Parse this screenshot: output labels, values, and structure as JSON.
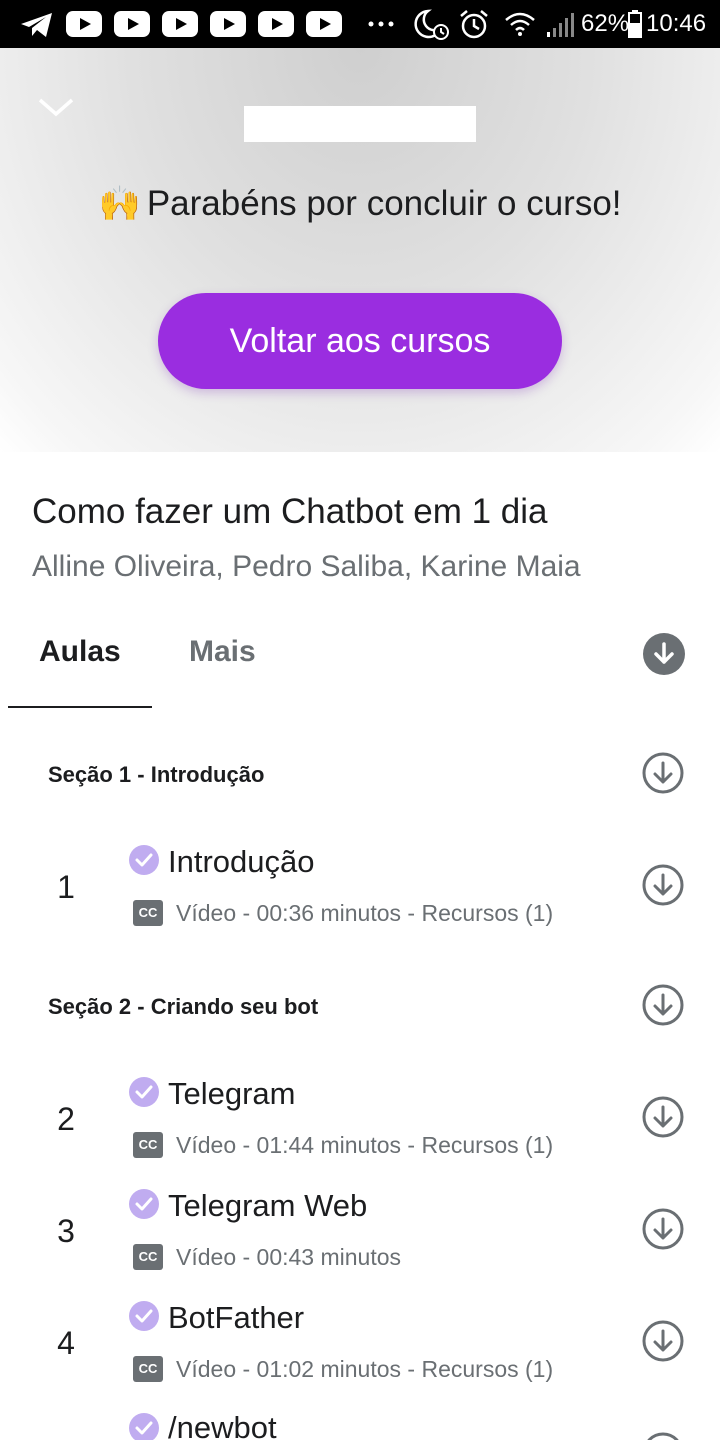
{
  "status_bar": {
    "battery": "62%",
    "time": "10:46",
    "icons": [
      "telegram-icon",
      "youtube-icon",
      "youtube-icon",
      "youtube-icon",
      "youtube-icon",
      "youtube-icon",
      "more-dots-icon",
      "moon-clock-icon",
      "alarm-icon",
      "wifi-icon",
      "signal-icon",
      "battery-icon"
    ]
  },
  "hero": {
    "congrats_emoji": "🙌",
    "congrats_text": "Parabéns por concluir o curso!",
    "back_button_label": "Voltar aos cursos"
  },
  "course": {
    "title": "Como fazer um Chatbot em 1 dia",
    "authors": "Alline Oliveira, Pedro Saliba, Karine Maia"
  },
  "tabs": {
    "lessons": "Aulas",
    "more": "Mais"
  },
  "sections": [
    {
      "title": "Seção 1 - Introdução"
    },
    {
      "title": "Seção 2 - Criando seu bot"
    }
  ],
  "lessons": [
    {
      "number": "1",
      "title": "Introdução",
      "meta": "Vídeo - 00:36 minutos - Recursos (1)"
    },
    {
      "number": "2",
      "title": "Telegram",
      "meta": "Vídeo - 01:44 minutos - Recursos (1)"
    },
    {
      "number": "3",
      "title": "Telegram Web",
      "meta": "Vídeo - 00:43 minutos"
    },
    {
      "number": "4",
      "title": "BotFather",
      "meta": "Vídeo - 01:02 minutos - Recursos (1)"
    },
    {
      "number": "",
      "title": "/newbot",
      "meta": ""
    }
  ],
  "cc_label": "CC",
  "colors": {
    "accent": "#9a2de0",
    "check": "#c0acf0",
    "muted": "#6a6f73"
  }
}
